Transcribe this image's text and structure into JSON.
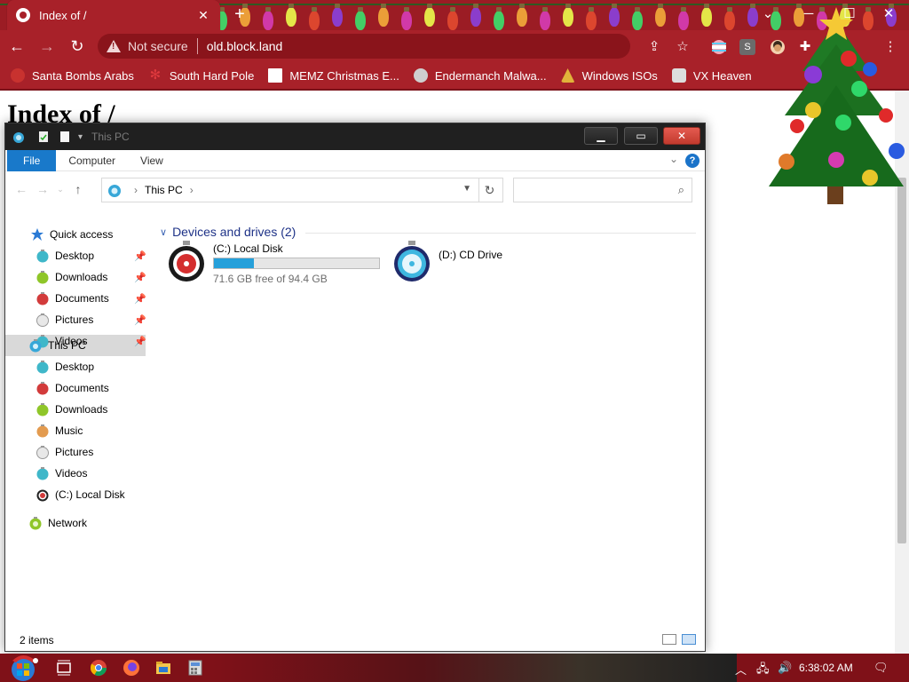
{
  "browser": {
    "tab_title": "Index of /",
    "tab_close": "✕",
    "new_tab": "+",
    "window_controls": {
      "minimize": "─",
      "maximize": "☐",
      "close": "✕",
      "tab_search": "⌄"
    },
    "security_label": "Not secure",
    "url": "old.block.land",
    "nav": {
      "back": "←",
      "forward": "→",
      "reload": "↻"
    },
    "toolbar_icons": [
      "share-icon",
      "star-icon",
      "extension-icon",
      "menu-icon"
    ]
  },
  "bookmarks": [
    {
      "label": "Santa Bombs Arabs",
      "icon": "santa-icon",
      "color": "#c8322f"
    },
    {
      "label": "South Hard Pole",
      "icon": "snowflake-icon",
      "color": "#e03a3e"
    },
    {
      "label": "MEMZ Christmas E...",
      "icon": "page-icon",
      "color": "#ffffff"
    },
    {
      "label": "Endermanch Malwa...",
      "icon": "raccoon-icon",
      "color": "#cfcfcf"
    },
    {
      "label": "Windows ISOs",
      "icon": "tree-icon",
      "color": "#e1b23a"
    },
    {
      "label": "VX Heaven",
      "icon": "vx-icon",
      "color": "#dddddd"
    }
  ],
  "webpage": {
    "heading": "Index of /"
  },
  "explorer": {
    "title": "This PC",
    "ribbon_tabs": [
      "File",
      "Computer",
      "View"
    ],
    "help": "?",
    "breadcrumb": "This PC",
    "search_placeholder": "",
    "quick_access": {
      "label": "Quick access",
      "items": [
        "Desktop",
        "Downloads",
        "Documents",
        "Pictures",
        "Videos"
      ]
    },
    "this_pc": {
      "label": "This PC",
      "items": [
        "Desktop",
        "Documents",
        "Downloads",
        "Music",
        "Pictures",
        "Videos",
        "(C:) Local Disk"
      ]
    },
    "network": "Network",
    "group_header": "Devices and drives (2)",
    "drives": [
      {
        "name": "(C:) Local Disk",
        "free_text": "71.6 GB free of 94.4 GB",
        "used_fraction": 0.2415
      },
      {
        "name": "(D:) CD Drive"
      }
    ],
    "status": "2 items"
  },
  "taskbar": {
    "clock": "6:38:02 AM",
    "apps": [
      "task-view-icon",
      "chrome-icon",
      "firefox-icon",
      "file-explorer-icon",
      "calculator-icon"
    ]
  }
}
